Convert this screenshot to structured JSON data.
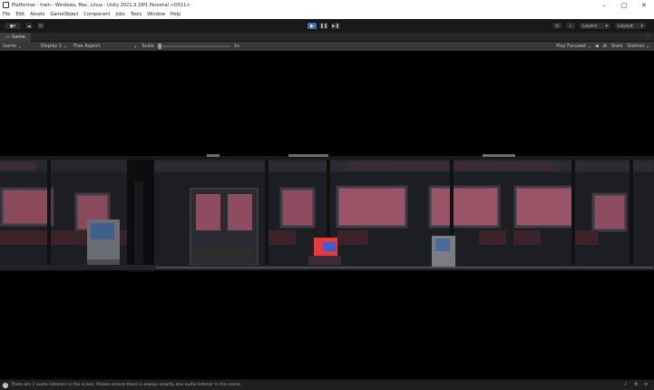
{
  "window": {
    "title": "Platformer - train - Windows, Mac, Linux - Unity 2021.3.18f1 Personal <DX11>",
    "minimize": "–",
    "maximize": "□",
    "close": "✕"
  },
  "menu": [
    "File",
    "Edit",
    "Assets",
    "GameObject",
    "Component",
    "Jobs",
    "Tools",
    "Window",
    "Help"
  ],
  "toolbar": {
    "play": "▶",
    "pause": "❚❚",
    "step": "▶❚",
    "layers": "Layers",
    "layout": "Layout"
  },
  "tab": {
    "label": "Game"
  },
  "gamebar": {
    "mode": "Game",
    "display": "Display 1",
    "aspect": "Free Aspect",
    "scale_label": "Scale",
    "scale_value": "1x",
    "play_focused": "Play Focused",
    "stats": "Stats",
    "gizmos": "Gizmos"
  },
  "status": {
    "message": "There are 2 audio listeners in the scene. Please ensure there is always exactly one audio listener in the scene."
  },
  "colors": {
    "accent": "#3a72b0",
    "window_pink": "#b8657a",
    "player_red": "#e8393c"
  }
}
